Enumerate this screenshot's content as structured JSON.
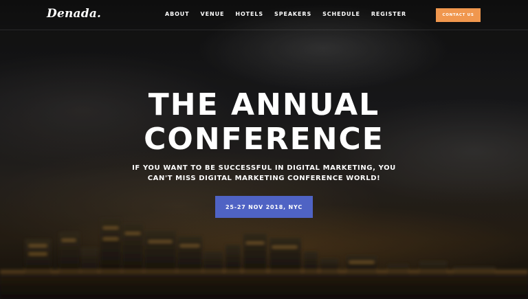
{
  "brand": {
    "logo": "Denada."
  },
  "nav": {
    "items": [
      "ABOUT",
      "VENUE",
      "HOTELS",
      "SPEAKERS",
      "SCHEDULE",
      "REGISTER"
    ]
  },
  "header": {
    "contact_label": "CONTACT US"
  },
  "hero": {
    "title_line1": "THE ANNUAL",
    "title_line2": "CONFERENCE",
    "subtitle_line1": "IF YOU WANT TO BE SUCCESSFUL IN DIGITAL MARKETING, YOU",
    "subtitle_line2": "CAN'T MISS DIGITAL MARKETING CONFERENCE WORLD!",
    "date_button": "25-27 NOV 2018, NYC"
  },
  "colors": {
    "accent_orange": "#f0974e",
    "primary_blue": "#4f63c4",
    "text": "#ffffff"
  }
}
